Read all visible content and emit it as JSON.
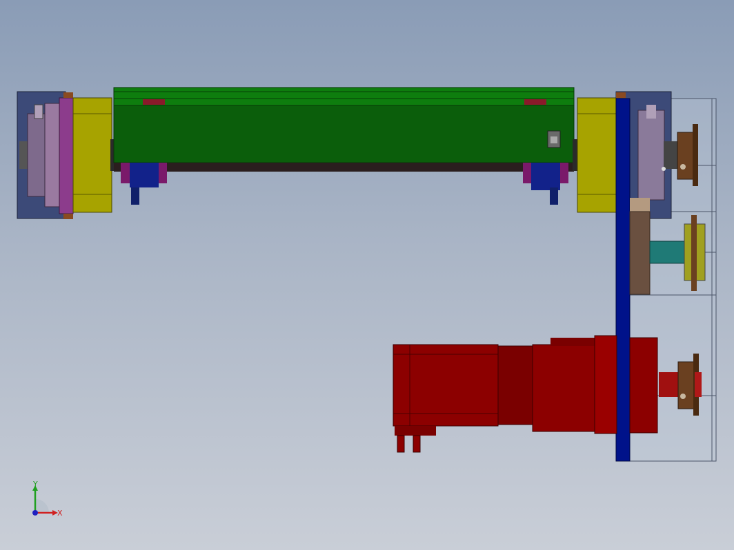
{
  "app": {
    "view": "cad-3d-viewport"
  },
  "triad": {
    "x_label": "X",
    "y_label": "Y",
    "x_color": "#d02020",
    "y_color": "#20a020",
    "z_color": "#2020c0"
  },
  "colors": {
    "background_top": "#8a9cb6",
    "background_bottom": "#c9ced7",
    "beam_green": "#0b6a0b",
    "bracket_yellow": "#a7a300",
    "plate_blue": "#00128a",
    "motor_red": "#8c0000",
    "bearing_purple": "#8a5a8a",
    "housing_slate": "#40507a",
    "sprocket_brown": "#6a4020",
    "shaft_teal": "#1f7a76"
  }
}
